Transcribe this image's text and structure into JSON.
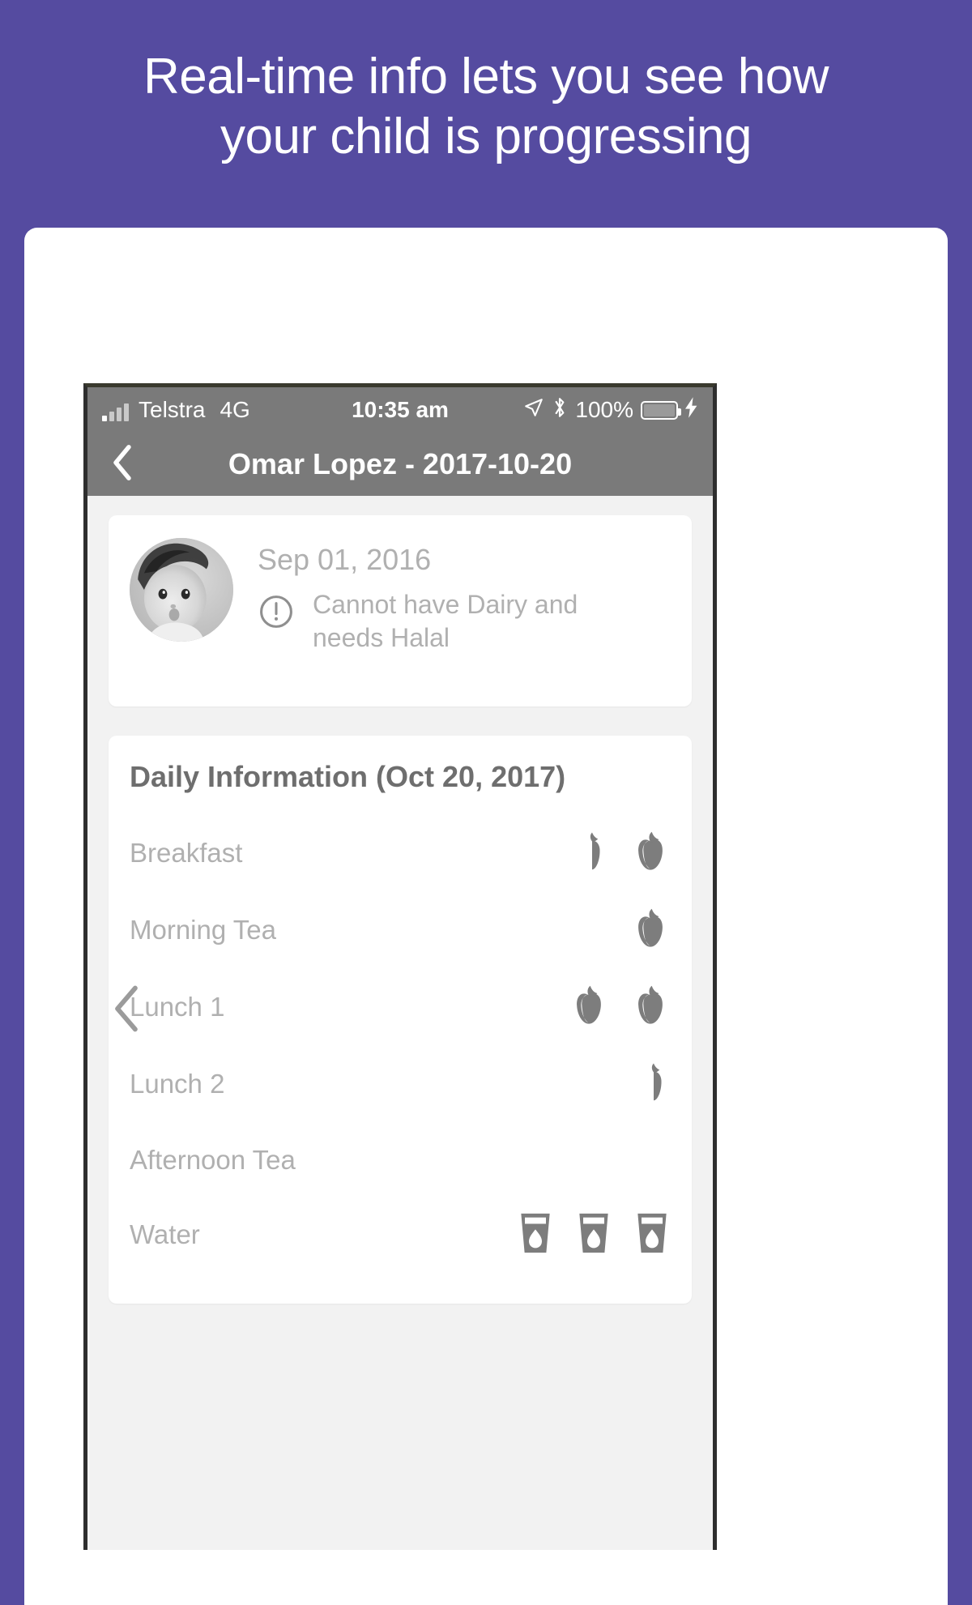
{
  "promo": {
    "line1": "Real-time info lets you see how",
    "line2": "your child is progressing",
    "background_color": "#554ba0",
    "text_color": "#ffffff"
  },
  "phone": {
    "status_bar": {
      "signal_icon": "signal-bars-icon",
      "carrier": "Telstra",
      "network": "4G",
      "time": "10:35 am",
      "location_icon": "location-arrow-icon",
      "bluetooth_icon": "bluetooth-icon",
      "battery_percent": "100%",
      "battery_icon": "battery-full-icon",
      "charging_icon": "lightning-bolt-icon"
    },
    "nav_bar": {
      "back_icon": "chevron-left-icon",
      "title": "Omar Lopez - 2017-10-20"
    },
    "profile_card": {
      "avatar": "child-photo-avatar",
      "date": "Sep 01, 2016",
      "alert_icon": "exclamation-circle-icon",
      "alert_text": "Cannot have Dairy and needs Halal"
    },
    "daily_card": {
      "title": "Daily Information (Oct 20, 2017)",
      "rows": [
        {
          "label": "Breakfast",
          "icons": [
            "half-apple-icon",
            "apple-icon"
          ]
        },
        {
          "label": "Morning Tea",
          "icons": [
            "apple-icon"
          ]
        },
        {
          "label": "Lunch 1",
          "icons": [
            "apple-icon",
            "apple-icon"
          ]
        },
        {
          "label": "Lunch 2",
          "icons": [
            "half-apple-icon"
          ]
        },
        {
          "label": "Afternoon Tea",
          "icons": []
        },
        {
          "label": "Water",
          "icons": [
            "water-cup-icon",
            "water-cup-icon",
            "water-cup-icon"
          ]
        }
      ]
    },
    "carousel_prev_icon": "chevron-left-icon"
  }
}
